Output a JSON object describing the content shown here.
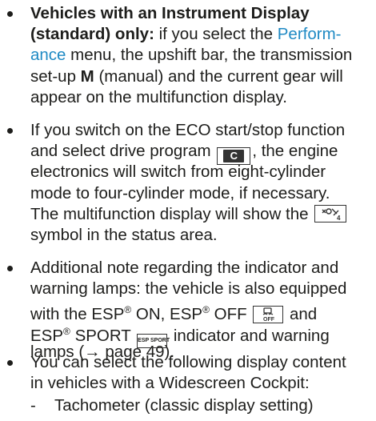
{
  "bullets": [
    {
      "lines": [
        {
          "bold": "Vehicles with an Instrument Display"
        },
        {
          "bold": "(standard) only:",
          "text": " if you select the ",
          "link": "Perform-"
        },
        {
          "link": "ance",
          "text": " menu, the upshift bar, the transmission"
        },
        {
          "text": "set-up ",
          "bold": "M",
          "text2": " (manual) and the current gear will"
        },
        {
          "text": "appear on the multifunction display."
        }
      ]
    },
    {
      "lines": [
        {
          "text": "If you switch on the ECO start/stop function"
        },
        {
          "text": "and select drive program ",
          "text2": ", the engine"
        },
        {
          "text": "electronics will switch from eight-cylinder"
        },
        {
          "text": "mode to four-cylinder mode, if necessary."
        },
        {
          "text": "The multifunction display will show the "
        },
        {
          "text": "symbol in the status area."
        }
      ],
      "key_c_label": "C"
    },
    {
      "lines": [
        {
          "text": "Additional note regarding the indicator and"
        },
        {
          "text": "warning lamps: the vehicle is also equipped"
        },
        {
          "text": "with the ESP",
          "sup": "®",
          "text2": " ON, ESP",
          "sup2": "®",
          "text3": " OFF ",
          "text4": " and"
        },
        {
          "text": "ESP",
          "sup": "®",
          "text2": " SPORT ",
          "text3": " indicator and warning"
        },
        {
          "text": "lamps (→ page 49)."
        }
      ],
      "esp_sport_key": "ESP SPORT",
      "off_key": "OFF"
    },
    {
      "lines": [
        {
          "text": "You can select the following display content"
        },
        {
          "text": "in vehicles with a Widescreen Cockpit:"
        }
      ]
    }
  ],
  "sub_item": {
    "dash": "-",
    "text": "Tachometer (classic display setting)"
  }
}
